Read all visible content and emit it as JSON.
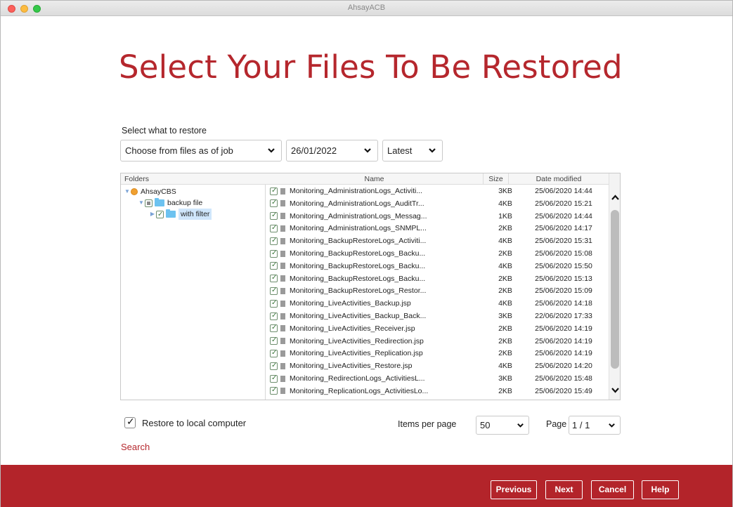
{
  "window": {
    "title": "AhsayACB"
  },
  "header": {
    "title": "Select Your Files To Be Restored"
  },
  "selection": {
    "label": "Select what to restore",
    "mode": "Choose from files as of job",
    "date": "26/01/2022",
    "version": "Latest"
  },
  "tree": {
    "header": "Folders",
    "root": "AhsayCBS",
    "child": "backup file",
    "grandchild": "with filter"
  },
  "files": {
    "headers": {
      "name": "Name",
      "size": "Size",
      "date": "Date modified"
    },
    "rows": [
      {
        "name": "Monitoring_AdministrationLogs_Activiti...",
        "size": "3KB",
        "date": "25/06/2020 14:44"
      },
      {
        "name": "Monitoring_AdministrationLogs_AuditTr...",
        "size": "4KB",
        "date": "25/06/2020 15:21"
      },
      {
        "name": "Monitoring_AdministrationLogs_Messag...",
        "size": "1KB",
        "date": "25/06/2020 14:44"
      },
      {
        "name": "Monitoring_AdministrationLogs_SNMPL...",
        "size": "2KB",
        "date": "25/06/2020 14:17"
      },
      {
        "name": "Monitoring_BackupRestoreLogs_Activiti...",
        "size": "4KB",
        "date": "25/06/2020 15:31"
      },
      {
        "name": "Monitoring_BackupRestoreLogs_Backu...",
        "size": "2KB",
        "date": "25/06/2020 15:08"
      },
      {
        "name": "Monitoring_BackupRestoreLogs_Backu...",
        "size": "4KB",
        "date": "25/06/2020 15:50"
      },
      {
        "name": "Monitoring_BackupRestoreLogs_Backu...",
        "size": "2KB",
        "date": "25/06/2020 15:13"
      },
      {
        "name": "Monitoring_BackupRestoreLogs_Restor...",
        "size": "2KB",
        "date": "25/06/2020 15:09"
      },
      {
        "name": "Monitoring_LiveActivities_Backup.jsp",
        "size": "4KB",
        "date": "25/06/2020 14:18"
      },
      {
        "name": "Monitoring_LiveActivities_Backup_Back...",
        "size": "3KB",
        "date": "22/06/2020 17:33"
      },
      {
        "name": "Monitoring_LiveActivities_Receiver.jsp",
        "size": "2KB",
        "date": "25/06/2020 14:19"
      },
      {
        "name": "Monitoring_LiveActivities_Redirection.jsp",
        "size": "2KB",
        "date": "25/06/2020 14:19"
      },
      {
        "name": "Monitoring_LiveActivities_Replication.jsp",
        "size": "2KB",
        "date": "25/06/2020 14:19"
      },
      {
        "name": "Monitoring_LiveActivities_Restore.jsp",
        "size": "4KB",
        "date": "25/06/2020 14:20"
      },
      {
        "name": "Monitoring_RedirectionLogs_ActivitiesL...",
        "size": "3KB",
        "date": "25/06/2020 15:48"
      },
      {
        "name": "Monitoring_ReplicationLogs_ActivitiesLo...",
        "size": "2KB",
        "date": "25/06/2020 15:49"
      }
    ]
  },
  "options": {
    "restore_local": "Restore to local computer",
    "items_per_page_label": "Items per page",
    "items_per_page": "50",
    "page_label": "Page",
    "page_value": "1 / 1"
  },
  "links": {
    "search": "Search"
  },
  "footer": {
    "previous": "Previous",
    "next": "Next",
    "cancel": "Cancel",
    "help": "Help"
  },
  "colors": {
    "brand": "#b3242a",
    "title": "#b5272d",
    "folder": "#6cc2f0"
  }
}
